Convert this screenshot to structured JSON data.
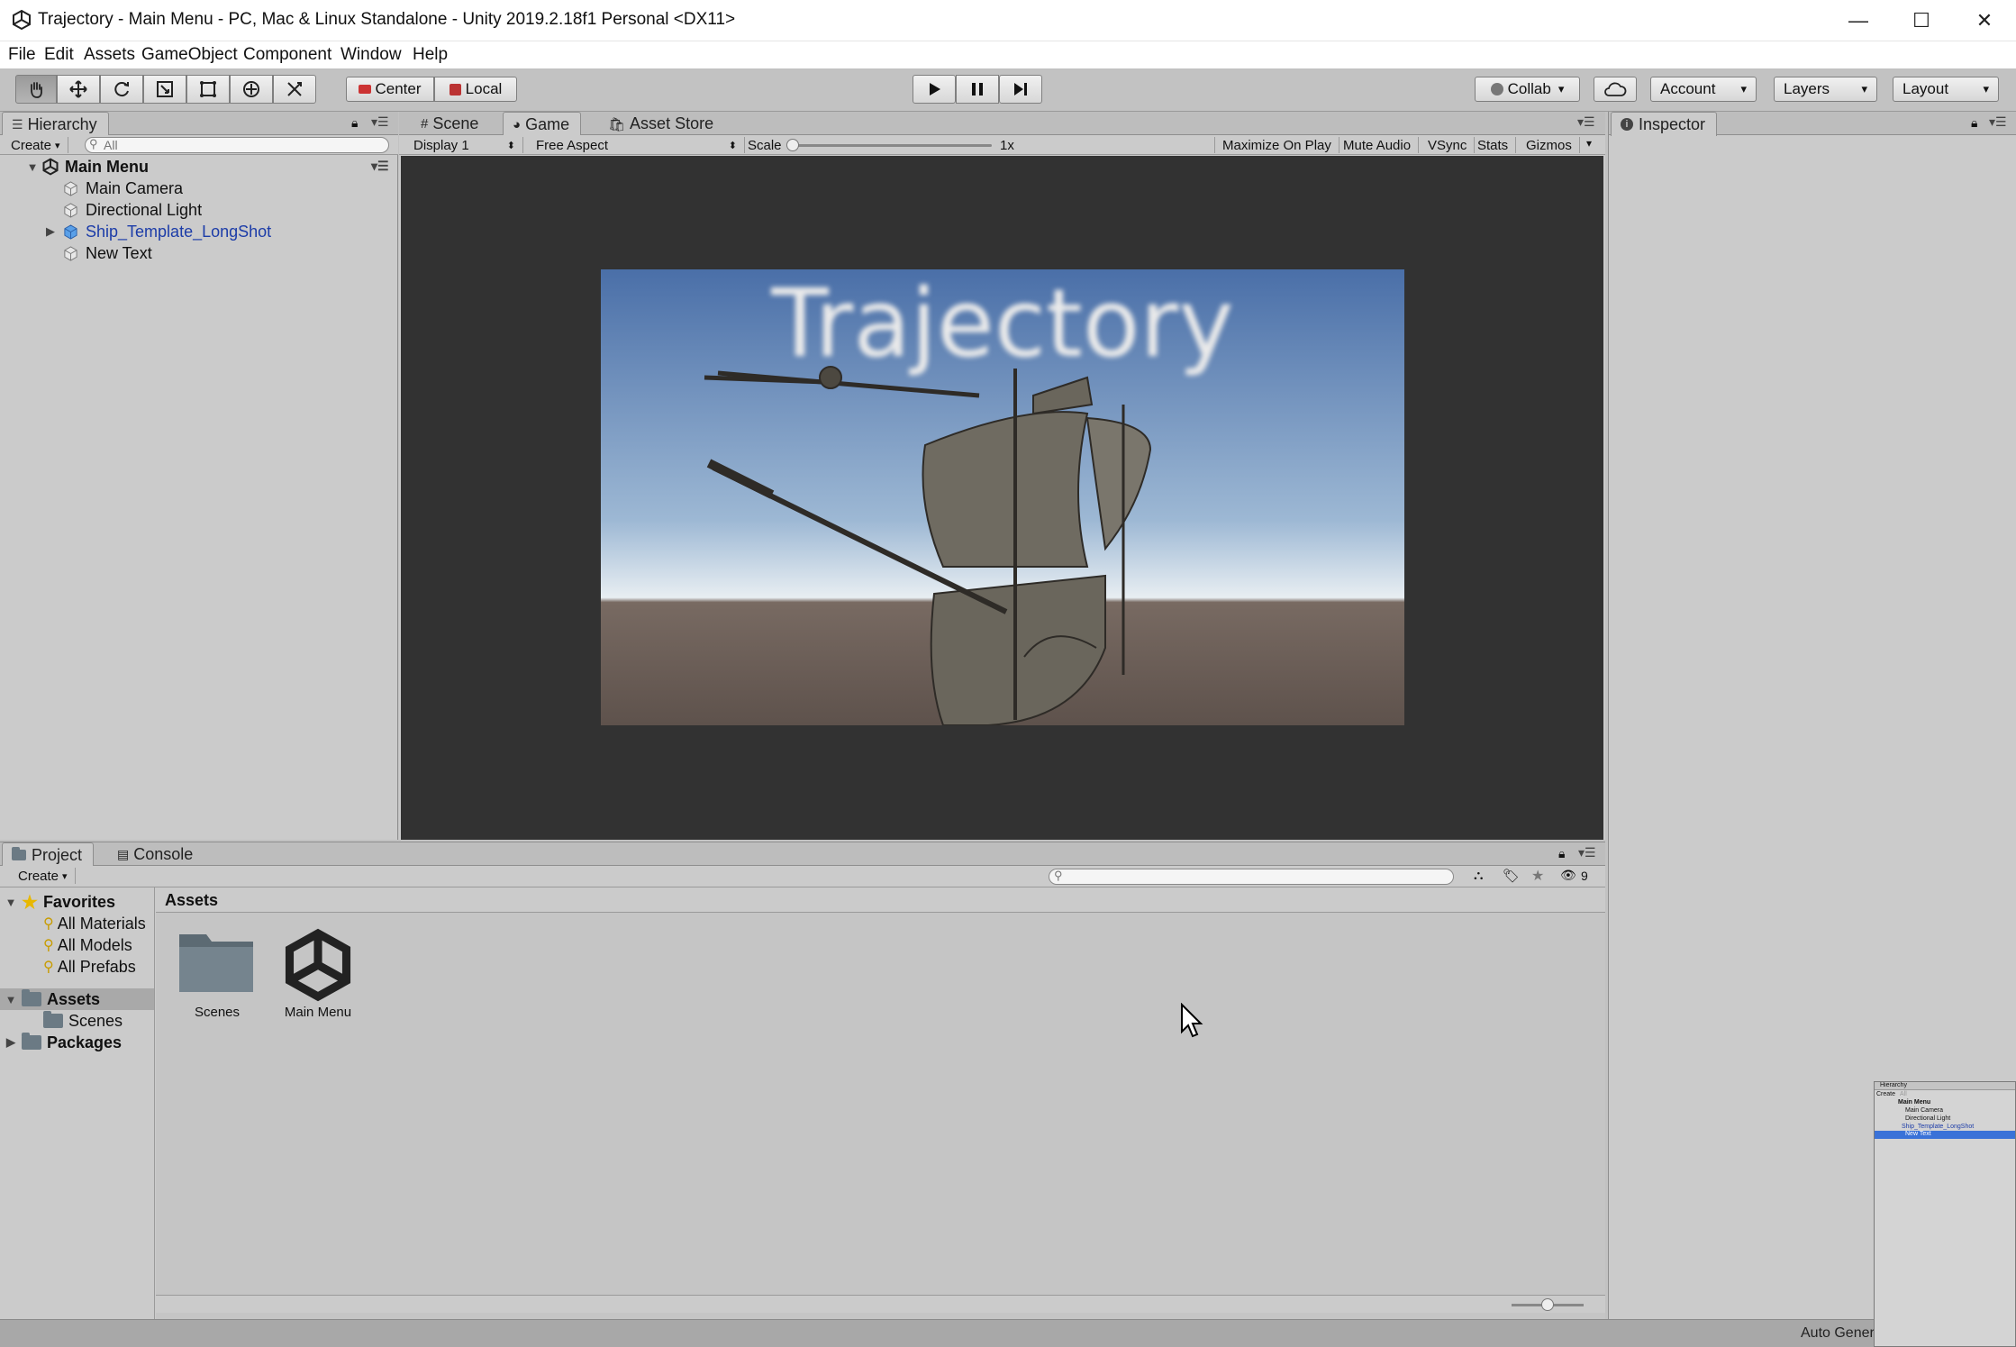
{
  "window": {
    "title": "Trajectory - Main Menu - PC, Mac & Linux Standalone - Unity 2019.2.18f1 Personal <DX11>",
    "minimize": "—",
    "maximize": "☐",
    "close": "✕"
  },
  "menu": [
    "File",
    "Edit",
    "Assets",
    "GameObject",
    "Component",
    "Window",
    "Help"
  ],
  "toolbar": {
    "pivot": "Center",
    "space": "Local",
    "collab": "Collab",
    "account": "Account",
    "layers": "Layers",
    "layout": "Layout"
  },
  "hierarchy": {
    "tab": "Hierarchy",
    "create": "Create",
    "search_placeholder": "All",
    "scene": "Main Menu",
    "items": [
      "Main Camera",
      "Directional Light",
      "Ship_Template_LongShot",
      "New Text"
    ]
  },
  "center_tabs": {
    "scene": "Scene",
    "game": "Game",
    "asset_store": "Asset Store"
  },
  "game_bar": {
    "display": "Display 1",
    "aspect": "Free Aspect",
    "scale_label": "Scale",
    "scale_value": "1x",
    "maximize": "Maximize On Play",
    "mute": "Mute Audio",
    "vsync": "VSync",
    "stats": "Stats",
    "gizmos": "Gizmos"
  },
  "game_view": {
    "title_text": "Trajectory"
  },
  "inspector": {
    "tab": "Inspector"
  },
  "bottom_tabs": {
    "project": "Project",
    "console": "Console"
  },
  "project": {
    "create": "Create",
    "hidden_count": "9",
    "favorites": "Favorites",
    "favorite_items": [
      "All Materials",
      "All Models",
      "All Prefabs"
    ],
    "assets_root": "Assets",
    "asset_children": [
      "Scenes"
    ],
    "packages": "Packages",
    "breadcrumb": "Assets",
    "grid": [
      {
        "label": "Scenes",
        "icon": "folder-icon"
      },
      {
        "label": "Main Menu",
        "icon": "unity-scene-icon"
      }
    ]
  },
  "status": {
    "text": "Auto Generate Lighting Off"
  },
  "thumb": {
    "title": "Hierarchy",
    "create": "Create",
    "search": "All",
    "scene": "Main Menu",
    "items": [
      "Main Camera",
      "Directional Light",
      "Ship_Template_LongShot",
      "New Text"
    ]
  },
  "colors": {
    "editor_bg": "#c2c2c2",
    "game_bg": "#323232",
    "selected_blue": "#3a72d8",
    "prefab_blue": "#1c3ca8"
  }
}
